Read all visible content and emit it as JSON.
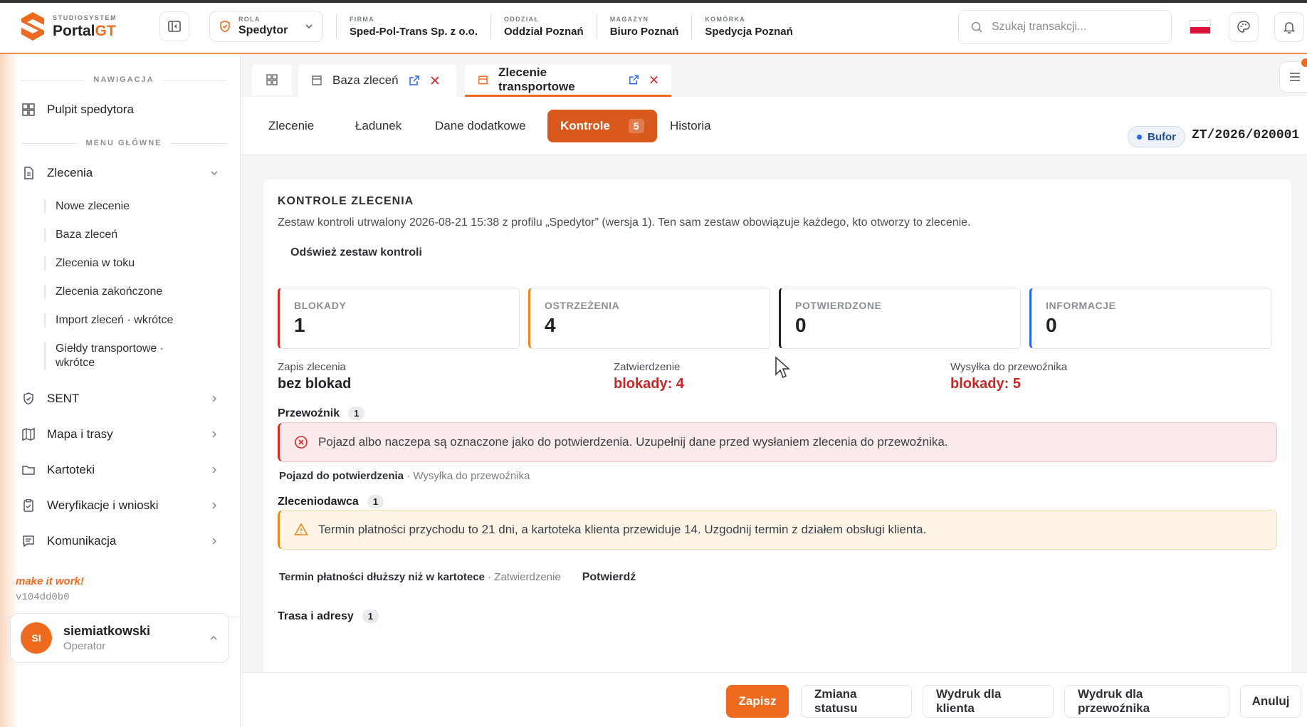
{
  "brand": {
    "small": "STUDIOSYSTEM",
    "name_a": "Portal",
    "name_b": "GT"
  },
  "header": {
    "role_label": "ROLA",
    "role_value": "Spedytor",
    "context": [
      {
        "label": "FIRMA",
        "value": "Sped-Pol-Trans Sp. z o.o."
      },
      {
        "label": "ODDZIAŁ",
        "value": "Oddział Poznań"
      },
      {
        "label": "MAGAZYN",
        "value": "Biuro Poznań"
      },
      {
        "label": "KOMÓRKA",
        "value": "Spedycja Poznań"
      }
    ],
    "search_placeholder": "Szukaj transakcji..."
  },
  "sidebar": {
    "section_nav": "NAWIGACJA",
    "dashboard": "Pulpit spedytora",
    "section_main": "MENU GŁÓWNE",
    "orders": "Zlecenia",
    "order_sub": [
      "Nowe zlecenie",
      "Baza zleceń",
      "Zlecenia w toku",
      "Zlecenia zakończone",
      "Import zleceń · wkrótce",
      "Giełdy transportowe · wkrótce"
    ],
    "items": [
      "SENT",
      "Mapa i trasy",
      "Kartoteki",
      "Weryfikacje i wnioski",
      "Komunikacja"
    ],
    "tagline": "make it work!",
    "version": "v104dd0b0",
    "user": {
      "initials": "SI",
      "name": "siemiatkowski",
      "role": "Operator"
    }
  },
  "tabs": [
    {
      "label": "Baza zleceń"
    },
    {
      "label": "Zlecenie transportowe"
    }
  ],
  "subtabs": {
    "zlecenie": "Zlecenie",
    "ladunek": "Ładunek",
    "dane": "Dane dodatkowe",
    "kontrole": "Kontrole",
    "kontrole_count": "5",
    "historia": "Historia"
  },
  "status": "Bufor",
  "order_number": "ZT/2026/020001",
  "card": {
    "title": "KONTROLE ZLECENIA",
    "description": "Zestaw kontroli utrwalony 2026-08-21 15:38 z profilu „Spedytor” (wersja 1). Ten sam zestaw obowiązuje każdego, kto otworzy to zlecenie.",
    "refresh": "Odśwież zestaw kontroli",
    "stats": [
      {
        "label": "BLOKADY",
        "value": "1",
        "color": "#dc2626"
      },
      {
        "label": "OSTRZEŻENIA",
        "value": "4",
        "color": "#e8891a"
      },
      {
        "label": "POTWIERDZONE",
        "value": "0",
        "color": "#1f2328"
      },
      {
        "label": "INFORMACJE",
        "value": "0",
        "color": "#2563eb"
      }
    ],
    "gates": [
      {
        "label": "Zapis zlecenia",
        "value": "bez blokad",
        "color": "#1f2328"
      },
      {
        "label": "Zatwierdzenie",
        "value": "blokady: 4",
        "color": "#c62828"
      },
      {
        "label": "Wysyłka do przewoźnika",
        "value": "blokady: 5",
        "color": "#c62828"
      }
    ],
    "groups": [
      {
        "title": "Przewoźnik",
        "count": "1",
        "alert": "Pojazd albo naczepa są oznaczone jako do potwierdzenia. Uzupełnij dane przed wysłaniem zlecenia do przewoźnika.",
        "meta_bold": "Pojazd do potwierdzenia",
        "meta": " · Wysyłka do przewoźnika",
        "action": ""
      },
      {
        "title": "Zleceniodawca",
        "count": "1",
        "alert": "Termin płatności przychodu to 21 dni, a kartoteka klienta przewiduje 14. Uzgodnij termin z działem obsługi klienta.",
        "meta_bold": "Termin płatności dłuższy niż w kartotece",
        "meta": " · Zatwierdzenie",
        "action": "Potwierdź"
      },
      {
        "title": "Trasa i adresy",
        "count": "1"
      }
    ]
  },
  "footer": {
    "save": "Zapisz",
    "status": "Zmiana statusu",
    "print_client": "Wydruk dla klienta",
    "print_carrier": "Wydruk dla przewoźnika",
    "cancel": "Anuluj"
  }
}
